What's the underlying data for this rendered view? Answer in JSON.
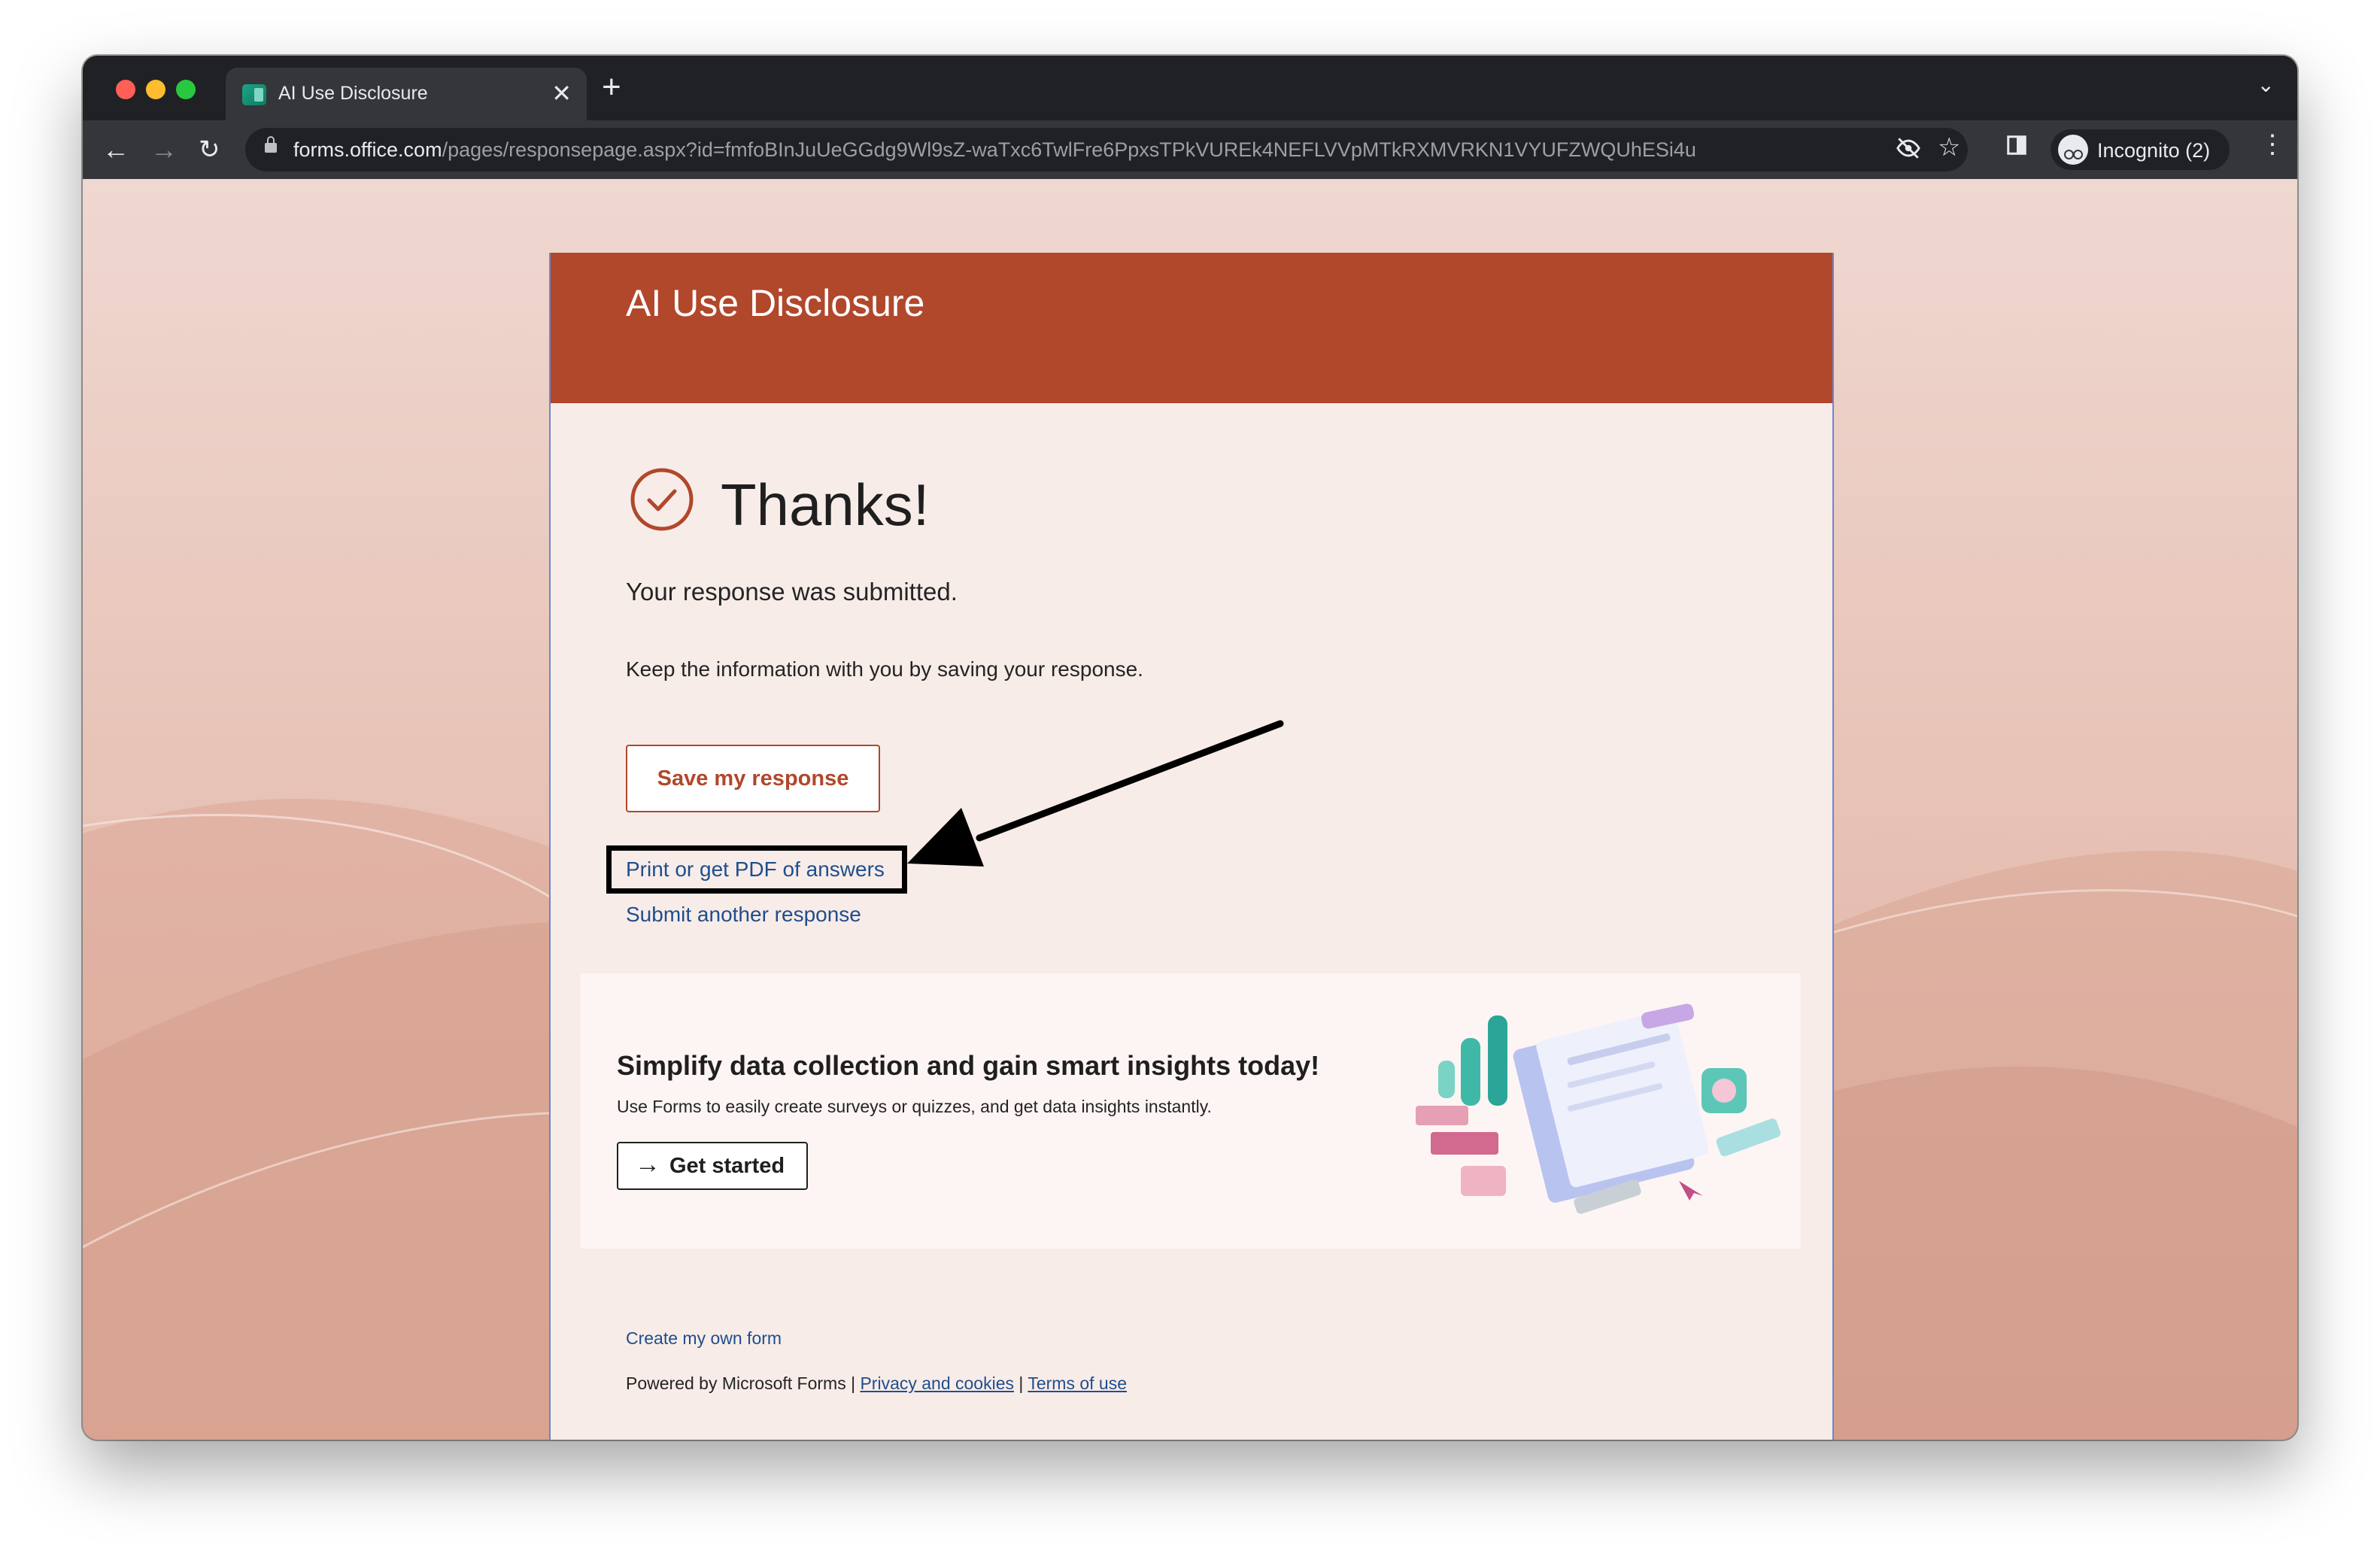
{
  "browser": {
    "tab_title": "AI Use Disclosure",
    "tab_close": "✕",
    "new_tab": "+",
    "url_host": "forms.office.com",
    "url_path": "/pages/responsepage.aspx?id=fmfoBInJuUeGGdg9Wl9sZ-waTxc6TwlFre6PpxsTPkVUREk4NEFLVVpMTkRXMVRKN1VYUFZWQUhESi4u",
    "incognito_label": "Incognito (2)",
    "icons": [
      "back-icon",
      "forward-icon",
      "reload-icon",
      "lock-icon",
      "eye-off-icon",
      "star-icon",
      "side-panel-icon",
      "incognito-icon",
      "menu-icon",
      "tab-list-icon"
    ]
  },
  "form": {
    "title": "AI Use Disclosure",
    "header_color": "#b1472b"
  },
  "confirmation": {
    "heading": "Thanks!",
    "submitted_message": "Your response was submitted.",
    "keep_message": "Keep the information with you by saving your response.",
    "save_button": "Save my response",
    "print_link": "Print or get PDF of answers",
    "another_link": "Submit another response"
  },
  "promo": {
    "heading": "Simplify data collection and gain smart insights today!",
    "subtext": "Use Forms to easily create surveys or quizzes, and get data insights instantly.",
    "button_label": "Get started"
  },
  "footer": {
    "create_link": "Create my own form",
    "powered_by": "Powered by Microsoft Forms | ",
    "privacy_link": "Privacy and cookies",
    "separator": " | ",
    "terms_link": "Terms of use"
  },
  "colors": {
    "accent": "#b1472b",
    "link": "#1e4e8c",
    "annotation": "#000000"
  }
}
